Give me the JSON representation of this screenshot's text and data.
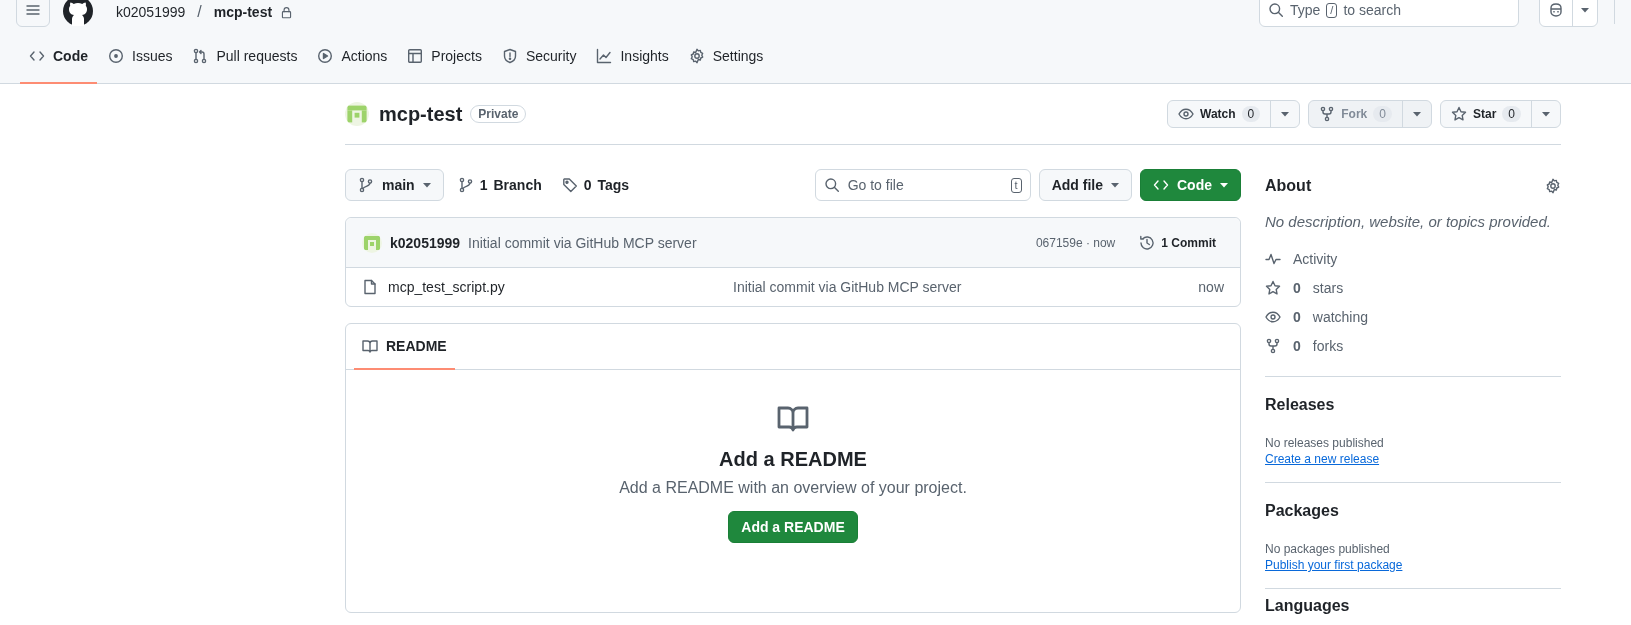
{
  "header": {
    "owner": "k02051999",
    "separator": "/",
    "repo": "mcp-test",
    "search": {
      "prefix": "Type",
      "key": "/",
      "suffix": "to search"
    }
  },
  "tabs": [
    {
      "label": "Code",
      "selected": true
    },
    {
      "label": "Issues",
      "selected": false
    },
    {
      "label": "Pull requests",
      "selected": false
    },
    {
      "label": "Actions",
      "selected": false
    },
    {
      "label": "Projects",
      "selected": false
    },
    {
      "label": "Security",
      "selected": false
    },
    {
      "label": "Insights",
      "selected": false
    },
    {
      "label": "Settings",
      "selected": false
    }
  ],
  "repo": {
    "name": "mcp-test",
    "visibility": "Private",
    "actions": [
      {
        "label": "Watch",
        "count": "0",
        "disabled": false
      },
      {
        "label": "Fork",
        "count": "0",
        "disabled": true
      },
      {
        "label": "Star",
        "count": "0",
        "disabled": false
      }
    ]
  },
  "toolbar": {
    "branch": "main",
    "branches": {
      "count": "1",
      "label": "Branch"
    },
    "tags": {
      "count": "0",
      "label": "Tags"
    },
    "go_to_file": {
      "placeholder": "Go to file",
      "shortcut": "t"
    },
    "add_file": "Add file",
    "code": "Code"
  },
  "commit": {
    "author": "k02051999",
    "message": "Initial commit via GitHub MCP server",
    "meta": "067159e · now",
    "commits": {
      "count": "1",
      "label": "Commit"
    }
  },
  "files": [
    {
      "name": "mcp_test_script.py",
      "message": "Initial commit via GitHub MCP server",
      "time": "now"
    }
  ],
  "readme": {
    "tab": "README",
    "tab_selected": true,
    "title": "Add a README",
    "text": "Add a README with an overview of your project.",
    "button": "Add a README"
  },
  "about": {
    "title": "About",
    "description": "No description, website, or topics provided.",
    "stats": [
      {
        "label": "Activity"
      },
      {
        "count": "0",
        "label": "stars"
      },
      {
        "count": "0",
        "label": "watching"
      },
      {
        "count": "0",
        "label": "forks"
      }
    ]
  },
  "releases": {
    "title": "Releases",
    "text": "No releases published",
    "link": "Create a new release"
  },
  "packages": {
    "title": "Packages",
    "text": "No packages published",
    "link": "Publish your first package"
  },
  "languages": {
    "title": "Languages"
  }
}
